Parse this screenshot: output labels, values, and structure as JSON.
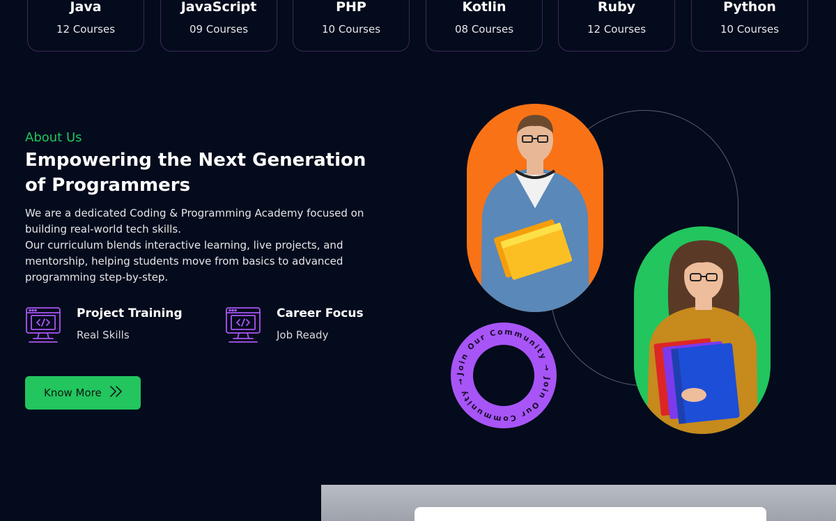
{
  "categories": [
    {
      "name": "Java",
      "courses": "12 Courses"
    },
    {
      "name": "JavaScript",
      "courses": "09 Courses"
    },
    {
      "name": "PHP",
      "courses": "10 Courses"
    },
    {
      "name": "Kotlin",
      "courses": "08 Courses"
    },
    {
      "name": "Ruby",
      "courses": "12 Courses"
    },
    {
      "name": "Python",
      "courses": "10 Courses"
    }
  ],
  "about": {
    "eyebrow": "About Us",
    "headline": "Empowering the Next Generation of Programmers",
    "para1": "We are a dedicated Coding & Programming Academy focused on building real-world tech skills.",
    "para2": "Our curriculum blends interactive learning, live projects, and mentorship, helping students move from basics to advanced programming step-by-step."
  },
  "features": [
    {
      "title": "Project Training",
      "subtitle": "Real Skills",
      "icon": "code-monitor-icon"
    },
    {
      "title": "Career Focus",
      "subtitle": "Job Ready",
      "icon": "code-monitor-icon"
    }
  ],
  "cta": {
    "label": "Know More",
    "icon": "double-chevron-right-icon"
  },
  "community_badge": {
    "text": "Join Our Community → Join Our Community →"
  },
  "colors": {
    "background": "#040b1c",
    "accent_green": "#22c55e",
    "accent_orange": "#f97316",
    "accent_purple": "#a855f7"
  }
}
